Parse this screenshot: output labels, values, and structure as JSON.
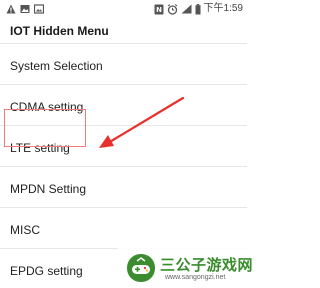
{
  "status_bar": {
    "time": "下午1:59",
    "left_icons": [
      "warning-icon",
      "image-icon",
      "gallery-icon"
    ],
    "right_icons": [
      "nfc-icon",
      "alarm-icon",
      "signal-icon",
      "battery-icon"
    ]
  },
  "app_bar": {
    "title": "IOT Hidden Menu"
  },
  "menu": {
    "items": [
      {
        "label": "System Selection"
      },
      {
        "label": "CDMA setting"
      },
      {
        "label": "LTE setting"
      },
      {
        "label": "MPDN Setting"
      },
      {
        "label": "MISC"
      },
      {
        "label": "EPDG setting"
      }
    ]
  },
  "annotation": {
    "highlight_color": "#f07d7d",
    "arrow_color": "#e8302a"
  },
  "watermark": {
    "text": "三公子游戏网",
    "url": "www.sangongzi.net",
    "color": "#3a8c2e"
  }
}
